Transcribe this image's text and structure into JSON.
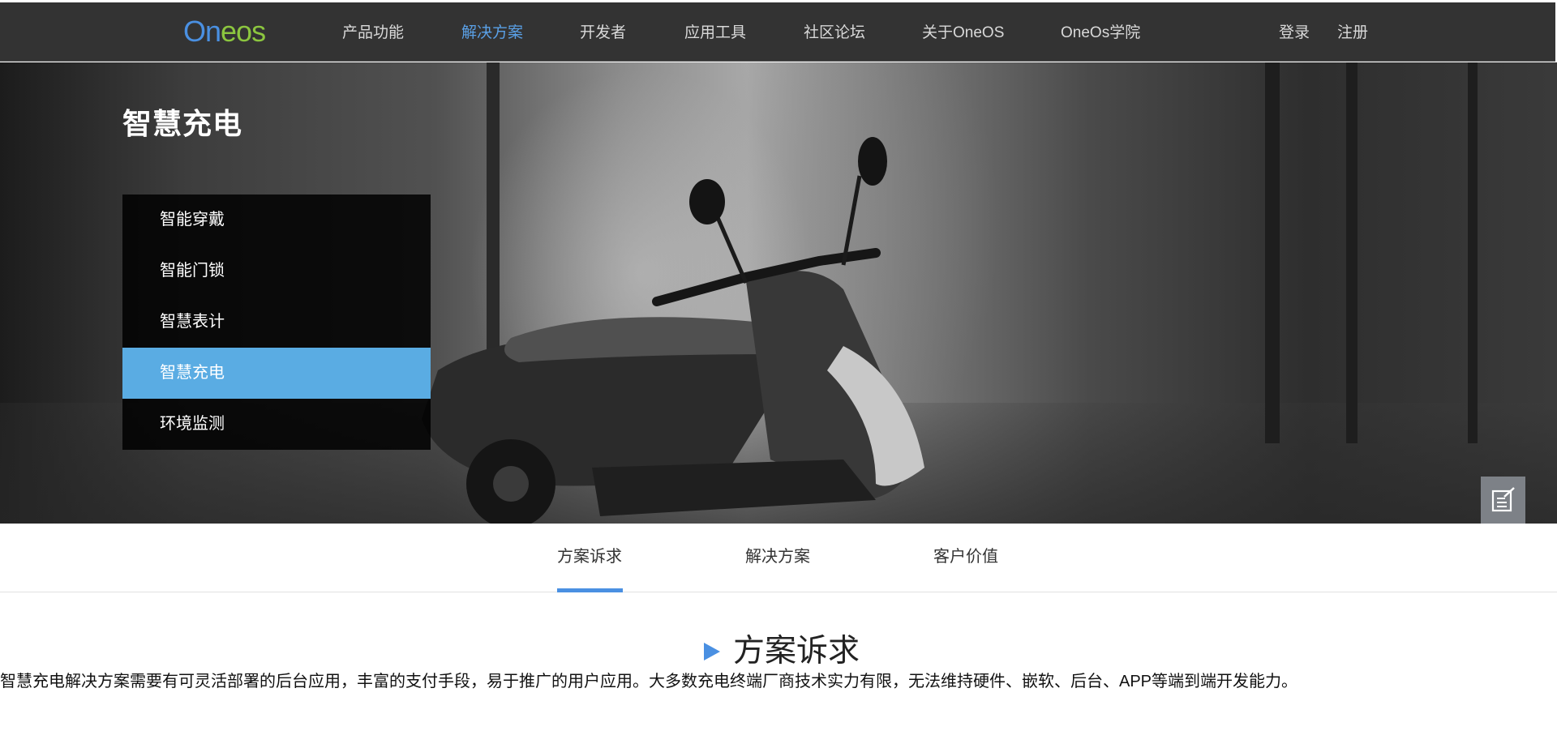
{
  "header": {
    "logo": {
      "part1": "On",
      "part2": "eos",
      "brand_colors": [
        "#4a90e2",
        "#8cc63f"
      ]
    },
    "nav": [
      {
        "label": "产品功能",
        "active": false
      },
      {
        "label": "解决方案",
        "active": true
      },
      {
        "label": "开发者",
        "active": false
      },
      {
        "label": "应用工具",
        "active": false
      },
      {
        "label": "社区论坛",
        "active": false
      },
      {
        "label": "关于OneOS",
        "active": false
      },
      {
        "label": "OneOs学院",
        "active": false
      }
    ],
    "auth": {
      "login": "登录",
      "register": "注册"
    }
  },
  "hero": {
    "title": "智慧充电",
    "menu": [
      {
        "label": "智能穿戴",
        "active": false
      },
      {
        "label": "智能门锁",
        "active": false
      },
      {
        "label": "智慧表计",
        "active": false
      },
      {
        "label": "智慧充电",
        "active": true
      },
      {
        "label": "环境监测",
        "active": false
      }
    ]
  },
  "floating_tools": [
    {
      "icon": "edit-note-icon"
    },
    {
      "icon": "add-user-icon"
    }
  ],
  "tabs": [
    {
      "label": "方案诉求",
      "active": true
    },
    {
      "label": "解决方案",
      "active": false
    },
    {
      "label": "客户价值",
      "active": false
    }
  ],
  "section": {
    "heading": "方案诉求",
    "body": "智慧充电解决方案需要有可灵活部署的后台应用，丰富的支付手段，易于推广的用户应用。大多数充电终端厂商技术实力有限，无法维持硬件、嵌软、后台、APP等端到端开发能力。"
  },
  "colors": {
    "accent": "#4a90e2",
    "menu_active": "#5aace3",
    "topbar": "#333333"
  }
}
